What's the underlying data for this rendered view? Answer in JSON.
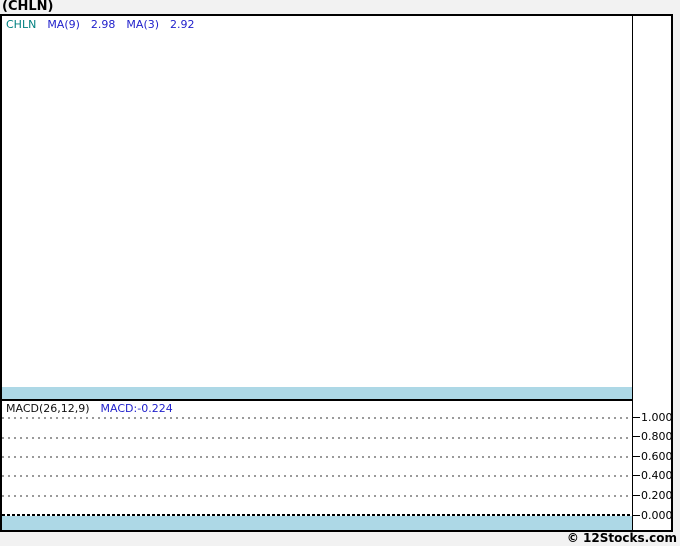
{
  "page": {
    "title": "(CHLN)",
    "footer": "© 12Stocks.com"
  },
  "colors": {
    "page_background": "#f2f2f2",
    "separator_band": "#add8e6",
    "symbol_text": "#008080",
    "indicator_text": "#2222cc"
  },
  "price_panel": {
    "legend": {
      "symbol": "CHLN",
      "items": [
        {
          "label": "MA(9)",
          "value": "2.98"
        },
        {
          "label": "MA(3)",
          "value": "2.92"
        }
      ]
    }
  },
  "macd_panel": {
    "legend": {
      "name": "MACD(26,12,9)",
      "value": "MACD:-0.224"
    },
    "axis_ticks": [
      "1.000",
      "0.800",
      "0.600",
      "0.400",
      "0.200",
      "0.000"
    ]
  },
  "chart_data": [
    {
      "type": "line",
      "title": "(CHLN) price panel",
      "series": [
        {
          "name": "CHLN",
          "x": [],
          "y": []
        },
        {
          "name": "MA(9)",
          "x": [],
          "y": [],
          "latest": 2.98
        },
        {
          "name": "MA(3)",
          "x": [],
          "y": [],
          "latest": 2.92
        }
      ],
      "legend_position": "top-left",
      "grid": false,
      "note": "Price panel is rendered empty in the screenshot: no candles, lines, or x-axis labels are drawn."
    },
    {
      "type": "line",
      "title": "MACD(26,12,9) panel",
      "series": [
        {
          "name": "MACD",
          "x": [],
          "y": [],
          "latest": -0.224
        }
      ],
      "ylim": [
        0.0,
        1.0
      ],
      "yticks": [
        1.0,
        0.8,
        0.6,
        0.4,
        0.2,
        0.0
      ],
      "legend_position": "top-left",
      "grid": true,
      "note": "Only dotted horizontal gridlines, a dense dotted zero line, and right-side y-axis tick labels are drawn; no MACD series is visible."
    }
  ]
}
